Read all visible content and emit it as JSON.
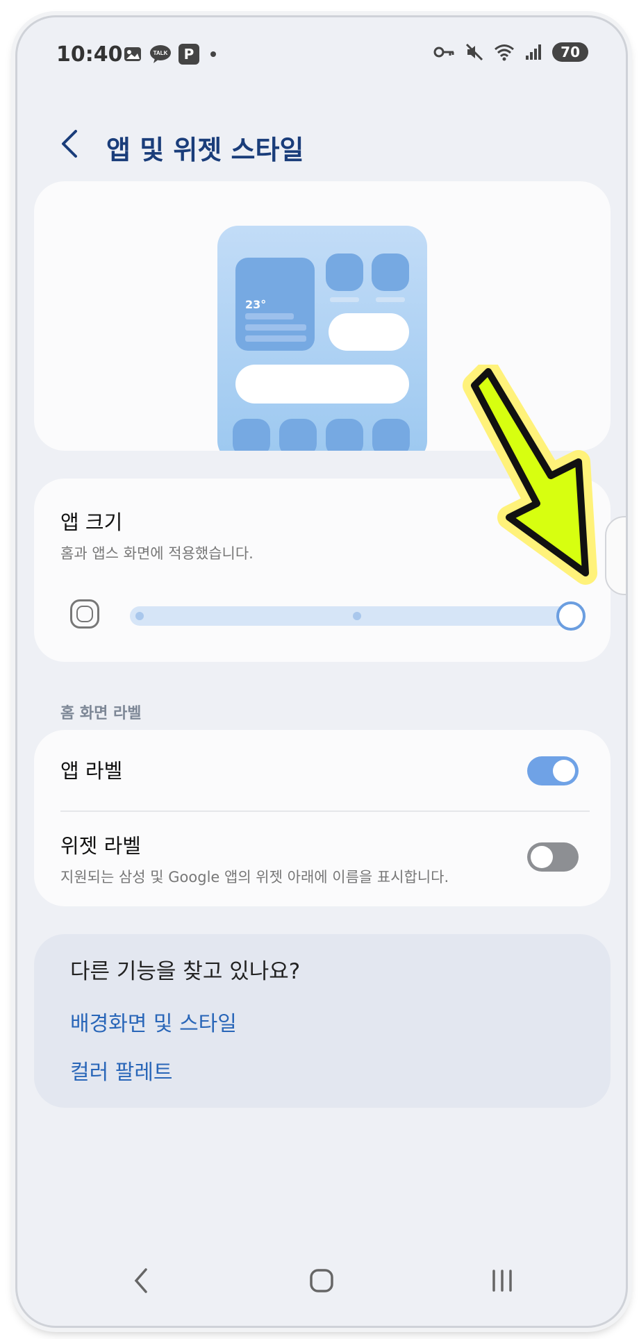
{
  "status_bar": {
    "time": "10:40",
    "left_icons": [
      "gallery-icon",
      "kakaotalk-icon",
      "parking-icon",
      "dot-icon"
    ],
    "kakao_label": "TALK",
    "parking_label": "P",
    "right_icons": [
      "vpn-key-icon",
      "mute-icon",
      "wifi-icon",
      "signal-icon"
    ],
    "battery": "70"
  },
  "header": {
    "title": "앱 및 위젯 스타일"
  },
  "preview": {
    "temperature": "23°"
  },
  "app_size": {
    "title": "앱 크기",
    "subtitle": "홈과 앱스 화면에 적용했습니다.",
    "slider_steps": 3,
    "slider_value": 3
  },
  "home_labels": {
    "section_label": "홈 화면 라벨",
    "app_label": {
      "title": "앱 라벨",
      "enabled": true
    },
    "widget_label": {
      "title": "위젯 라벨",
      "subtitle": "지원되는 삼성 및 Google 앱의 위젯 아래에 이름을 표시합니다.",
      "enabled": false
    }
  },
  "more": {
    "title": "다른 기능을 찾고 있나요?",
    "links": [
      "배경화면 및 스타일",
      "컬러 팔레트"
    ]
  },
  "nav_bar": {
    "items": [
      "back-icon",
      "home-icon",
      "recents-icon"
    ]
  },
  "colors": {
    "accent": "#6fa2e6",
    "title": "#1a3d7a",
    "link": "#2966b8",
    "annotation_arrow": "#d7ff10"
  }
}
